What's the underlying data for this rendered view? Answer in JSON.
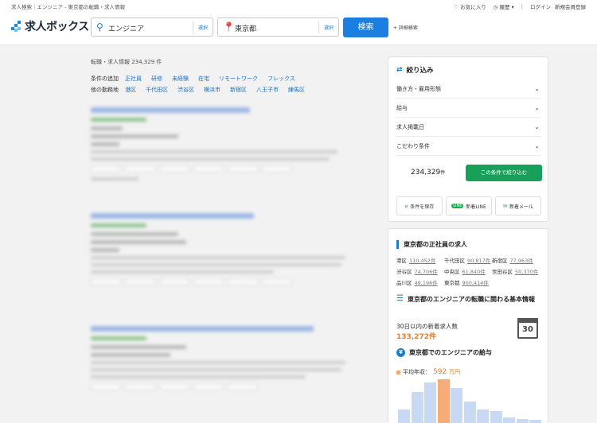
{
  "top_nav": {
    "breadcrumb": "求人検索｜エンジニア - 東京都の転職・求人情報",
    "favorite": "お気に入り",
    "history": "履歴",
    "login": "ログイン",
    "register": "新規会員登録"
  },
  "header": {
    "logo": "求人ボックス",
    "keyword_value": "エンジニア",
    "location_value": "東京都",
    "select_label": "選択",
    "search_button": "検索",
    "detail_search": "+ 詳細検索"
  },
  "results": {
    "count_text": "転職・求人情報 234,329 件",
    "conditions_label": "条件の追加",
    "conditions": [
      "正社員",
      "研修",
      "未経験",
      "在宅",
      "リモートワーク",
      "フレックス"
    ],
    "areas_label": "他の勤務地",
    "areas": [
      "港区",
      "千代田区",
      "渋谷区",
      "横浜市",
      "新宿区",
      "八王子市",
      "練馬区"
    ]
  },
  "filter": {
    "title": "絞り込み",
    "rows": [
      "働き方・雇用形態",
      "給与",
      "求人掲載日",
      "こだわり条件"
    ],
    "result_count": "234,329",
    "result_unit": "件",
    "apply_button": "この条件で絞り込む",
    "save_button": "条件を保存",
    "line_button": "新着LINE",
    "mail_button": "新着メール"
  },
  "stats": {
    "area_title": "東京都の正社員の求人",
    "area_rows": [
      [
        {
          "k": "港区",
          "v": "110,452件"
        },
        {
          "k": "千代田区",
          "v": "90,817件"
        },
        {
          "k": "新宿区",
          "v": "77,963件"
        }
      ],
      [
        {
          "k": "渋谷区",
          "v": "74,706件"
        },
        {
          "k": "中央区",
          "v": "61,840件"
        },
        {
          "k": "世田谷区",
          "v": "50,370件"
        }
      ],
      [
        {
          "k": "品川区",
          "v": "49,196件"
        },
        {
          "k": "東京都",
          "v": "900,414件"
        }
      ]
    ],
    "info_title": "東京都のエンジニアの転職に関わる基本情報",
    "new_label": "30日以内の新着求人数",
    "new_value": "133,272件",
    "calendar_day": "30",
    "salary_title": "東京都でのエンジニアの給与",
    "avg_label": "平均年収：",
    "avg_value": "592",
    "avg_unit": "万円"
  },
  "colors": {
    "accent": "#1a7fe0",
    "green": "#18a05b",
    "orange": "#f07b2a"
  },
  "chart_data": {
    "type": "bar",
    "values": [
      14,
      32,
      42,
      45,
      36,
      22,
      14,
      12,
      6,
      4,
      3
    ],
    "highlight_index": 3
  }
}
